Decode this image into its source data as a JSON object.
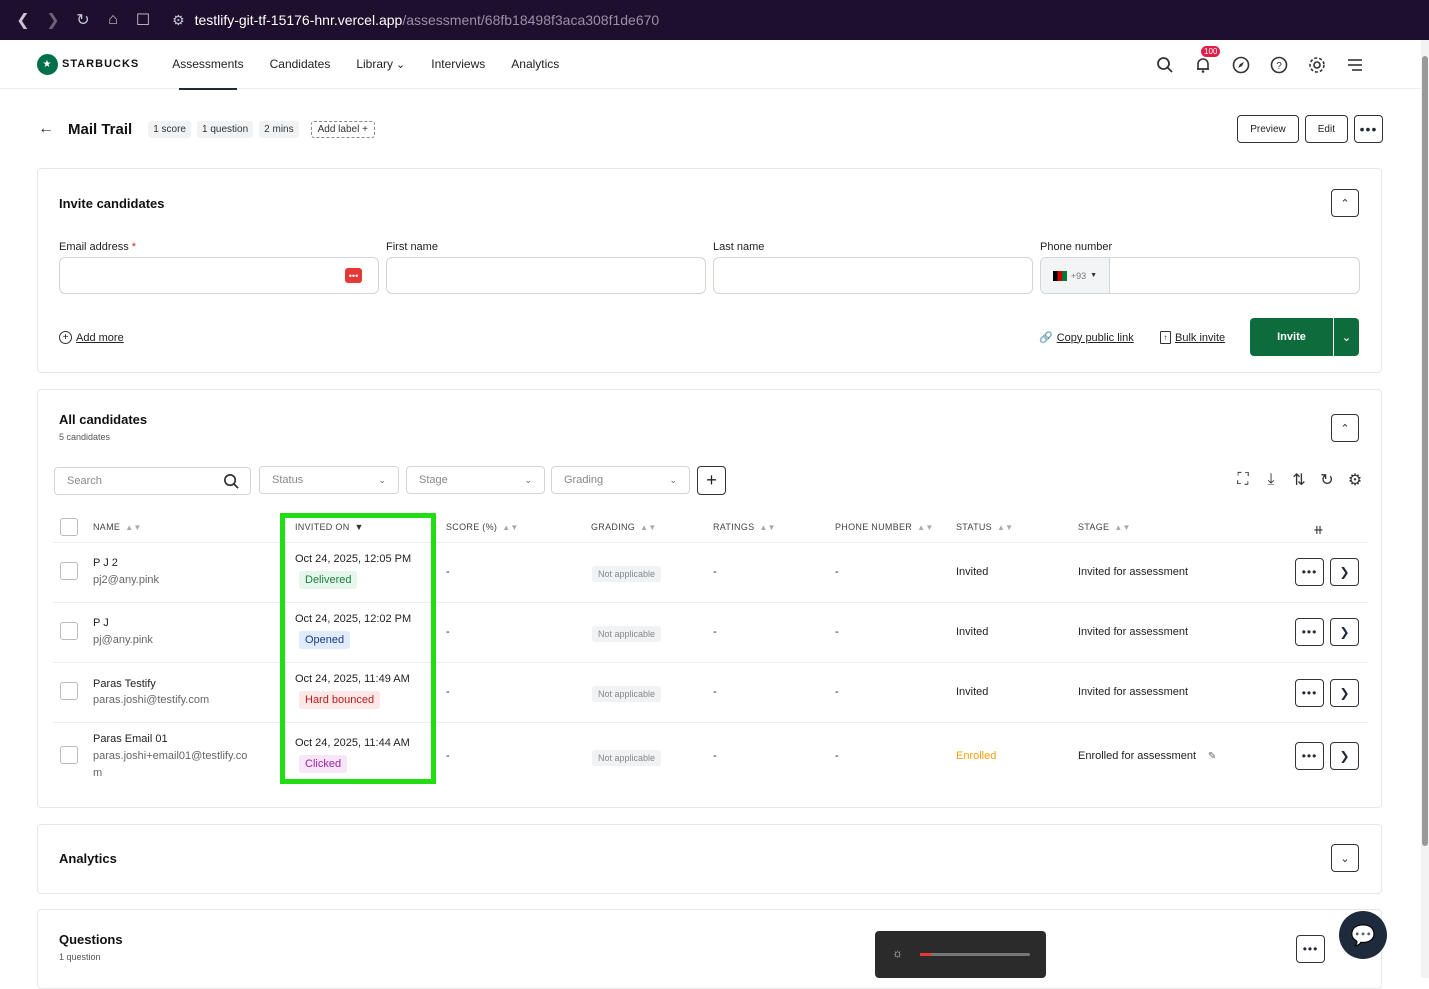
{
  "browser": {
    "url_host": "testlify-git-tf-15176-hnr.vercel.app",
    "url_path": "/assessment/68fb18498f3aca308f1de670"
  },
  "brand": {
    "name": "STARBUCKS",
    "mark": "★",
    "color": "#00704a"
  },
  "nav": {
    "items": [
      "Assessments",
      "Candidates",
      "Library",
      "Interviews",
      "Analytics"
    ],
    "library_chevron": "⌄",
    "notification_count": "100"
  },
  "assessment": {
    "title": "Mail Trail",
    "chips": [
      "1 score",
      "1 question",
      "2 mins"
    ],
    "add_label": "Add label +",
    "actions": {
      "preview": "Preview",
      "edit": "Edit",
      "more": "•••"
    }
  },
  "invite": {
    "title": "Invite candidates",
    "email_label": "Email address",
    "email_required": "*",
    "first_name_label": "First name",
    "last_name_label": "Last name",
    "phone_label": "Phone number",
    "phone_prefix": "+93",
    "add_more": "Add more",
    "copy_public_link": "Copy public link",
    "bulk_invite": "Bulk invite",
    "invite_button": "Invite",
    "pw_icon": "•••"
  },
  "candidates": {
    "title": "All candidates",
    "count_label": "5 candidates",
    "search_placeholder": "Search",
    "filters": [
      "Status",
      "Stage",
      "Grading"
    ],
    "columns": [
      "NAME",
      "INVITED ON",
      "SCORE (%)",
      "GRADING",
      "RATINGS",
      "PHONE NUMBER",
      "STATUS",
      "STAGE"
    ],
    "rows": [
      {
        "name": "P J 2",
        "email": "pj2@any.pink",
        "invited_on": "Oct 24, 2025, 12:05 PM",
        "mail_status": "Delivered",
        "score": "-",
        "grading": "Not applicable",
        "ratings": "-",
        "phone": "-",
        "status": "Invited",
        "stage": "Invited for assessment"
      },
      {
        "name": "P J",
        "email": "pj@any.pink",
        "invited_on": "Oct 24, 2025, 12:02 PM",
        "mail_status": "Opened",
        "score": "-",
        "grading": "Not applicable",
        "ratings": "-",
        "phone": "-",
        "status": "Invited",
        "stage": "Invited for assessment"
      },
      {
        "name": "Paras Testify",
        "email": "paras.joshi@testify.com",
        "invited_on": "Oct 24, 2025, 11:49 AM",
        "mail_status": "Hard bounced",
        "score": "-",
        "grading": "Not applicable",
        "ratings": "-",
        "phone": "-",
        "status": "Invited",
        "stage": "Invited for assessment"
      },
      {
        "name": "Paras Email 01",
        "email": "paras.joshi+email01@testlify.co",
        "email_2": "m",
        "invited_on": "Oct 24, 2025, 11:44 AM",
        "mail_status": "Clicked",
        "score": "-",
        "grading": "Not applicable",
        "ratings": "-",
        "phone": "-",
        "status": "Enrolled",
        "stage": "Enrolled for assessment"
      }
    ],
    "pill_colors": {
      "Delivered": {
        "bg": "#e7f6ec",
        "fg": "#15803d"
      },
      "Opened": {
        "bg": "#e0ecfb",
        "fg": "#1e3a8a"
      },
      "Hard bounced": {
        "bg": "#fde7e7",
        "fg": "#b91c1c"
      },
      "Clicked": {
        "bg": "#f6e6f7",
        "fg": "#9d1fa6"
      }
    },
    "enrolled_color": "#f59e0b"
  },
  "analytics": {
    "title": "Analytics"
  },
  "questions": {
    "title": "Questions",
    "count_label": "1 question"
  },
  "highlight_color": "#22dd11"
}
